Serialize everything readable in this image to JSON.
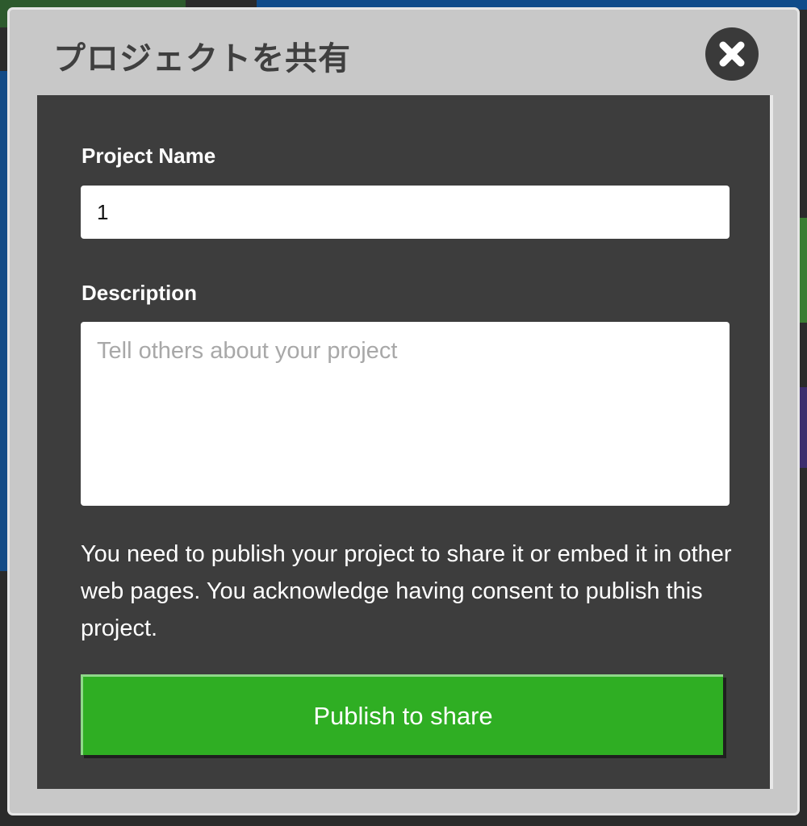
{
  "modal": {
    "title": "プロジェクトを共有",
    "close_icon": "close-x-circle-icon"
  },
  "form": {
    "name_label": "Project Name",
    "name_value": "1",
    "description_label": "Description",
    "description_value": "",
    "description_placeholder": "Tell others about your project"
  },
  "notice": "You need to publish your project to share it or embed it in other web pages. You acknowledge having consent to publish this project.",
  "publish_button_label": "Publish to share",
  "colors": {
    "header_bg": "#c8c8c8",
    "body_bg": "#3d3d3d",
    "button_bg": "#2fae23",
    "close_bg": "#3a3a3a"
  }
}
